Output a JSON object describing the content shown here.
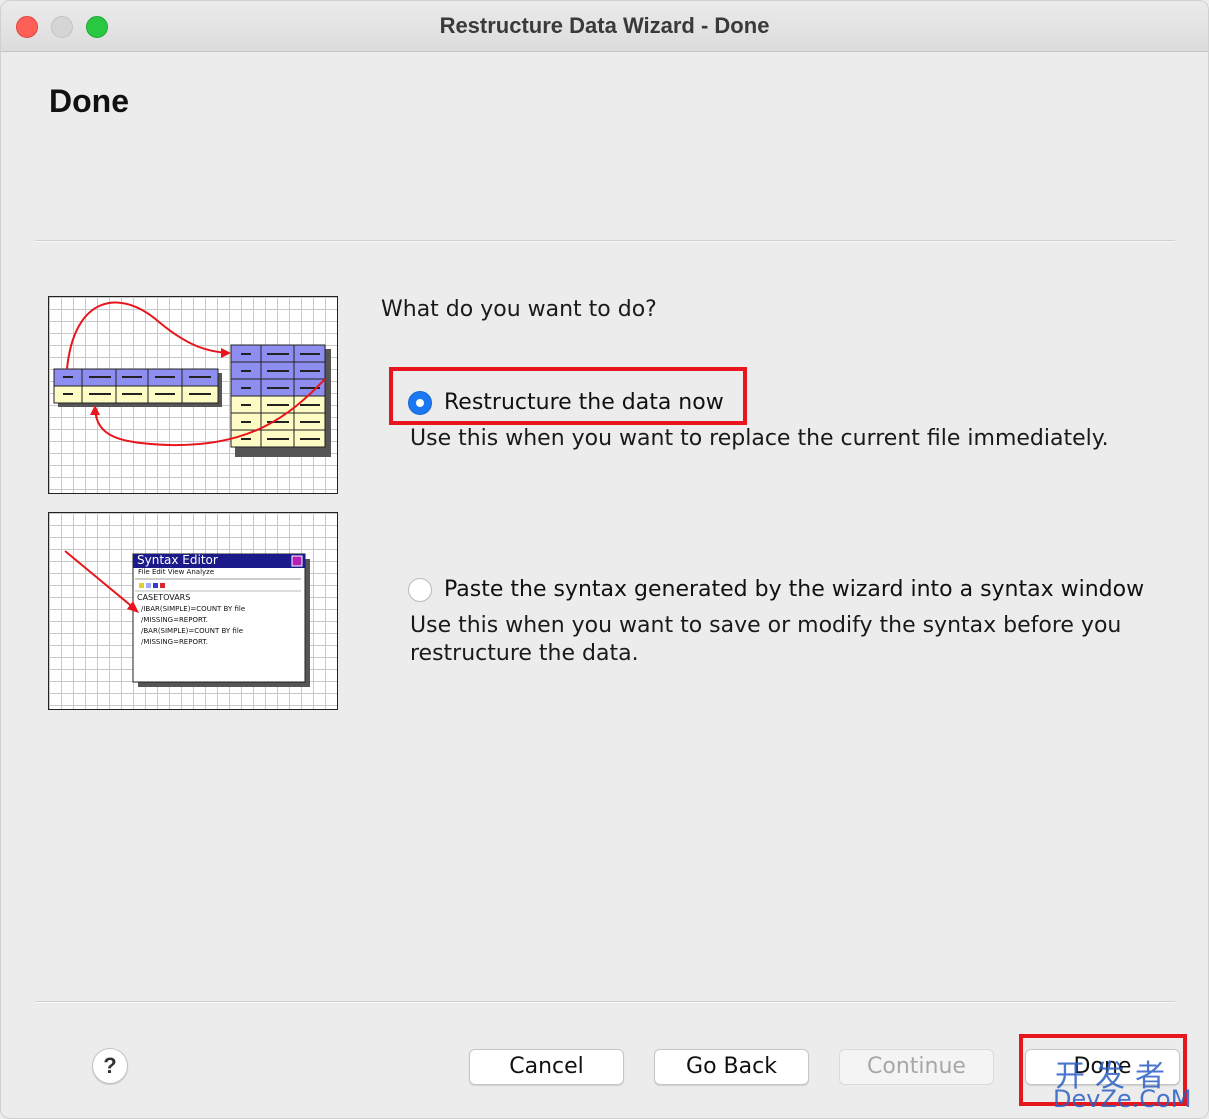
{
  "window": {
    "title": "Restructure Data Wizard - Done"
  },
  "page": {
    "heading": "Done",
    "question": "What do you want to do?"
  },
  "options": [
    {
      "label": "Restructure the data now",
      "description": "Use this when you want to replace the current file immediately.",
      "selected": true
    },
    {
      "label": "Paste the syntax generated by the wizard into a syntax window",
      "description": "Use this when you want to save or modify the syntax before you restructure the data.",
      "selected": false
    }
  ],
  "illustration_syntax": {
    "title": "Syntax Editor",
    "menu": "File Edit View Analyze"
  },
  "buttons": {
    "help": "?",
    "cancel": "Cancel",
    "go_back": "Go Back",
    "continue": "Continue",
    "done": "Done"
  },
  "watermark": {
    "cn": "开发者",
    "en": "DevZe.CoM"
  },
  "colors": {
    "highlight": "#e8151c",
    "radio_selected": "#1b78f3",
    "illustration_blue": "#8e8ef0",
    "illustration_yellow": "#fdfcc5",
    "illustration_arrow": "#e8151c",
    "syntax_title_bar": "#1a1a8a"
  }
}
